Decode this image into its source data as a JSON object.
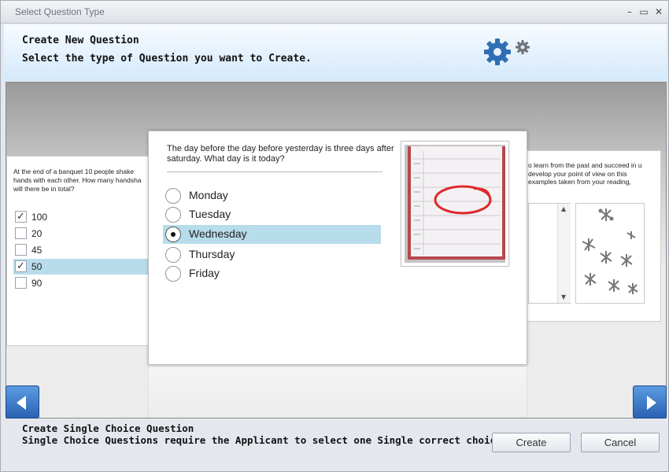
{
  "window": {
    "title": "Select Question Type",
    "controls": [
      "minimize",
      "maximize",
      "close"
    ]
  },
  "header": {
    "line1": "Create New Question",
    "line2": "Select the type of Question you want to Create.",
    "icon": "gears-icon"
  },
  "left_card": {
    "question": "At the end of a banquet 10 people shake hands with each other. How many handsha will there be in total?",
    "options": [
      {
        "label": "100",
        "checked": true,
        "highlighted": false
      },
      {
        "label": "20",
        "checked": false,
        "highlighted": false
      },
      {
        "label": "45",
        "checked": false,
        "highlighted": false
      },
      {
        "label": "50",
        "checked": true,
        "highlighted": true
      },
      {
        "label": "90",
        "checked": false,
        "highlighted": false
      }
    ]
  },
  "center_card": {
    "question": "The day before the day before yesterday is three days after saturday. What day is it today?",
    "options": [
      {
        "label": "Monday",
        "selected": false
      },
      {
        "label": "Tuesday",
        "selected": false
      },
      {
        "label": "Wednesday",
        "selected": true
      },
      {
        "label": "Thursday",
        "selected": false
      },
      {
        "label": "Friday",
        "selected": false
      }
    ],
    "image": "calendar-photo"
  },
  "right_card": {
    "question": "o learn from the past and succeed in u develop your point of view on this examples taken from your reading,",
    "image": "jacks-picture"
  },
  "navigation": {
    "prev": "previous-arrow",
    "next": "next-arrow"
  },
  "footer": {
    "line1": "Create Single Choice Question",
    "line2": "Single Choice Questions require the Applicant to select one Single correct choice.",
    "create_label": "Create",
    "cancel_label": "Cancel"
  },
  "colors": {
    "header_bg": "#d4e9fb",
    "selection": "#b7dcec",
    "nav_button": "#3572c4"
  }
}
